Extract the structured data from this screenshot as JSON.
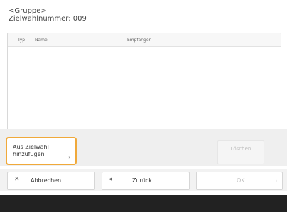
{
  "header": {
    "group_label": "<Gruppe>",
    "speed_dial_number": "Zielwahlnummer: 009"
  },
  "list": {
    "columns": [
      "Typ",
      "Name",
      "Empfänger"
    ],
    "rows": []
  },
  "actions": {
    "add_line1": "Aus Zielwahl",
    "add_line2": "hinzufügen",
    "delete_label": "Löschen"
  },
  "bottom_bar": {
    "cancel_label": "Abbrechen",
    "back_label": "Zurück",
    "ok_label": "OK"
  },
  "icons": {
    "cancel": "x-icon",
    "back": "left-arrow-icon",
    "ok_corner": "return-corner-icon",
    "add_chevron": "small-chevron-icon"
  },
  "colors": {
    "highlight_border": "#f0a93a",
    "footer": "#222222",
    "disabled_text": "#bdbdbd"
  }
}
